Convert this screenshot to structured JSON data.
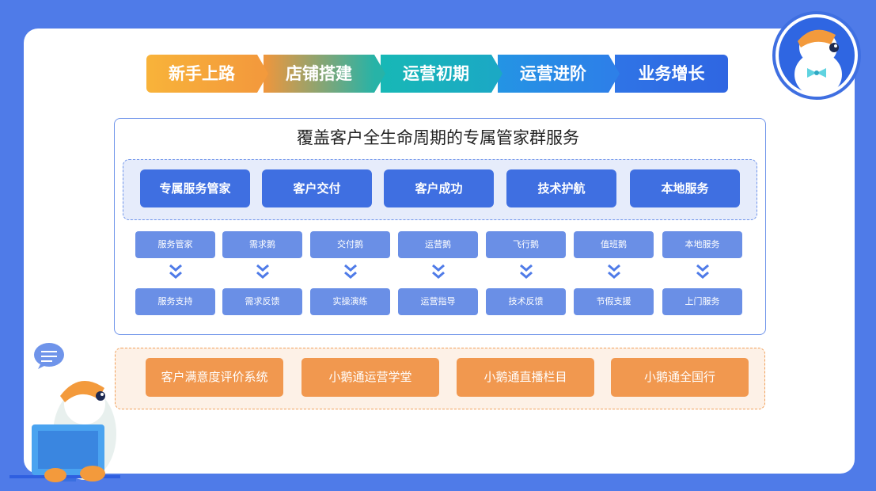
{
  "stages": [
    "新手上路",
    "店铺搭建",
    "运营初期",
    "运营进阶",
    "业务增长"
  ],
  "main_title": "覆盖客户全生命周期的专属管家群服务",
  "services": [
    "专属服务管家",
    "客户交付",
    "客户成功",
    "技术护航",
    "本地服务"
  ],
  "top_row": [
    "服务管家",
    "需求鹅",
    "交付鹅",
    "运营鹅",
    "飞行鹅",
    "值班鹅",
    "本地服务"
  ],
  "bottom_row": [
    "服务支持",
    "需求反馈",
    "实操演练",
    "运营指导",
    "技术反馈",
    "节假支援",
    "上门服务"
  ],
  "bottom_boxes": [
    "客户满意度评价系统",
    "小鹅通运营学堂",
    "小鹅通直播栏目",
    "小鹅通全国行"
  ],
  "colors": {
    "background": "#4f7be8",
    "stage_1": "#f5a43a",
    "stage_2": "#f09a3a",
    "stage_3": "#19b5b5",
    "stage_4": "#2b8be8",
    "stage_5": "#2f6fe4",
    "service_button": "#3f6fe1",
    "small_box": "#6a8fe6",
    "orange_button": "#f1984f"
  }
}
